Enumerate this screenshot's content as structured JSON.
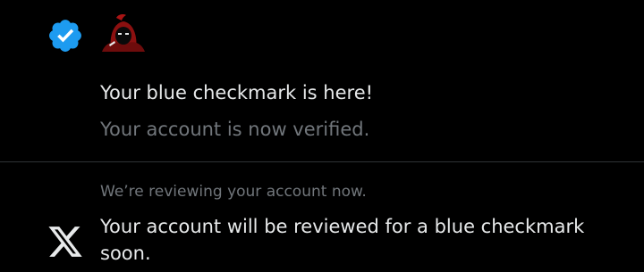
{
  "notifications": [
    {
      "icon": "verified-badge-icon",
      "icon_color": "#1d9bf0",
      "avatar": "hooded-figure-avatar",
      "title": "Your blue checkmark is here!",
      "subtitle": "Your account is now verified."
    },
    {
      "icon": "x-logo-icon",
      "meta": "We’re reviewing your account now.",
      "body": "Your account will be reviewed for a blue checkmark soon."
    }
  ],
  "colors": {
    "background": "#000000",
    "primary_text": "#e7e9ea",
    "secondary_text": "#71767b",
    "divider": "#2f3336",
    "verified_blue": "#1d9bf0"
  }
}
